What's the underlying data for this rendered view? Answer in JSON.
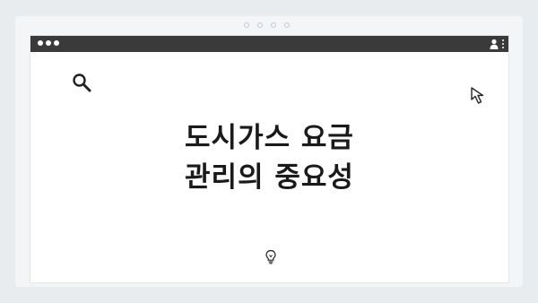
{
  "frame": {
    "background": "#f3f5f7",
    "outer_background": "#e9ecef"
  },
  "window": {
    "titlebar_color": "#3a3a3a",
    "icons": [
      "window-dot-icon",
      "user-icon",
      "kebab-menu-icon"
    ]
  },
  "slide": {
    "title_line1": "도시가스 요금",
    "title_line2": "관리의 중요성",
    "icons": [
      "search-icon",
      "cursor-arrow-icon",
      "lightbulb-icon"
    ]
  }
}
